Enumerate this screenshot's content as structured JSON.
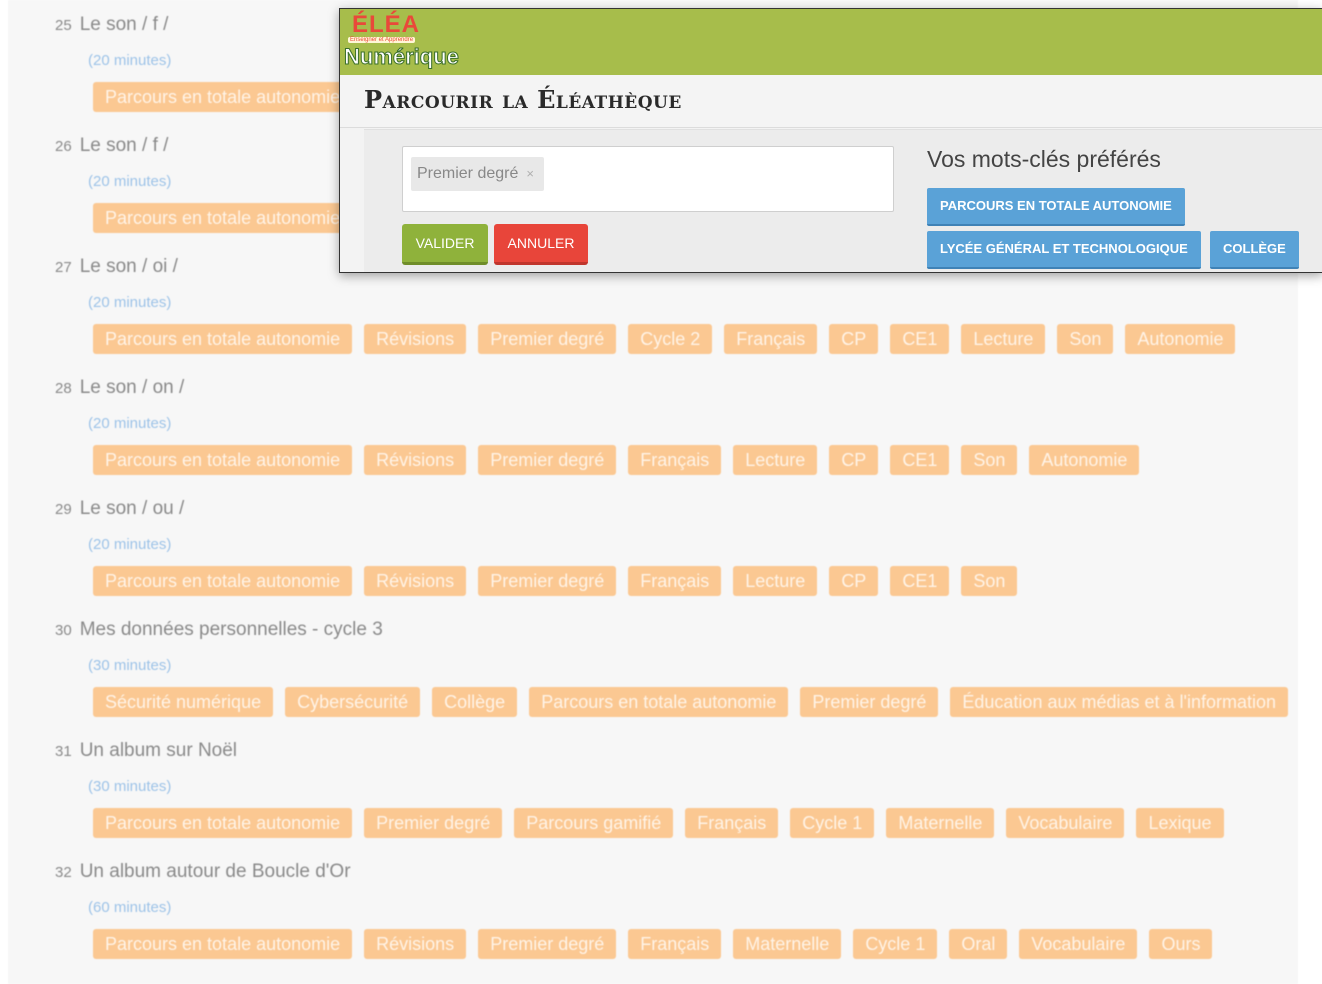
{
  "list": {
    "items": [
      {
        "num": "25",
        "title": "Le son / f /",
        "duration": "(20 minutes)",
        "tags": [
          "Parcours en totale autonomie"
        ]
      },
      {
        "num": "26",
        "title": "Le son / f /",
        "duration": "(20 minutes)",
        "tags": [
          "Parcours en totale autonomie"
        ]
      },
      {
        "num": "27",
        "title": "Le son / oi /",
        "duration": "(20 minutes)",
        "tags": [
          "Parcours en totale autonomie",
          "Révisions",
          "Premier degré",
          "Cycle 2",
          "Français",
          "CP",
          "CE1",
          "Lecture",
          "Son",
          "Autonomie"
        ]
      },
      {
        "num": "28",
        "title": "Le son / on /",
        "duration": "(20 minutes)",
        "tags": [
          "Parcours en totale autonomie",
          "Révisions",
          "Premier degré",
          "Français",
          "Lecture",
          "CP",
          "CE1",
          "Son",
          "Autonomie"
        ]
      },
      {
        "num": "29",
        "title": "Le son / ou /",
        "duration": "(20 minutes)",
        "tags": [
          "Parcours en totale autonomie",
          "Révisions",
          "Premier degré",
          "Français",
          "Lecture",
          "CP",
          "CE1",
          "Son"
        ]
      },
      {
        "num": "30",
        "title": "Mes données personnelles - cycle 3",
        "duration": "(30 minutes)",
        "tags": [
          "Sécurité numérique",
          "Cybersécurité",
          "Collège",
          "Parcours en totale autonomie",
          "Premier degré",
          "Éducation aux médias et à l'information"
        ]
      },
      {
        "num": "31",
        "title": "Un album sur Noël",
        "duration": "(30 minutes)",
        "tags": [
          "Parcours en totale autonomie",
          "Premier degré",
          "Parcours gamifié",
          "Français",
          "Cycle 1",
          "Maternelle",
          "Vocabulaire",
          "Lexique"
        ]
      },
      {
        "num": "32",
        "title": "Un album autour de Boucle d'Or",
        "duration": "(60 minutes)",
        "tags": [
          "Parcours en totale autonomie",
          "Révisions",
          "Premier degré",
          "Français",
          "Maternelle",
          "Cycle 1",
          "Oral",
          "Vocabulaire",
          "Ours"
        ]
      }
    ]
  },
  "panel": {
    "logo": {
      "top": "ÉLÉA",
      "sub": "Enseigner et Apprendre",
      "bottom": "Numérique"
    },
    "title": "Parcourir la Éléathèque",
    "keyword_chip": "Premier degré",
    "keyword_chip_close": "×",
    "valider_label": "VALIDER",
    "annuler_label": "ANNULER",
    "fav_title": "Vos mots-clés préférés",
    "favorites": [
      "PARCOURS EN TOTALE AUTONOMIE",
      "LYCÉE GÉNÉRAL ET TECHNOLOGIQUE",
      "COLLÈGE"
    ]
  },
  "colors": {
    "header_green": "#a7bd4b",
    "tag_orange": "#fbc892",
    "fav_blue": "#5aa2d7",
    "valider_green": "#8fb23b",
    "annuler_red": "#e8453a"
  }
}
